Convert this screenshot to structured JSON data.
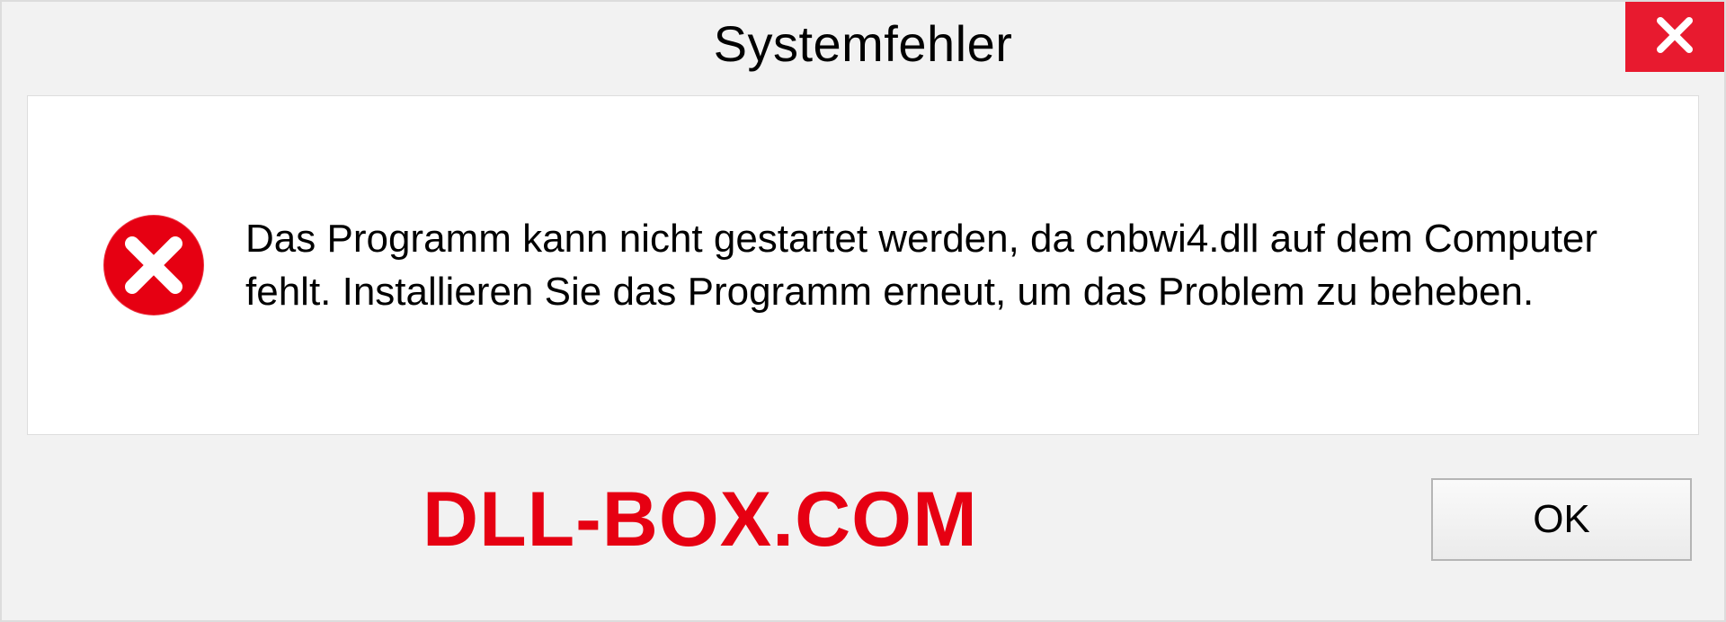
{
  "dialog": {
    "title": "Systemfehler",
    "message": "Das Programm kann nicht gestartet werden, da cnbwi4.dll auf dem Computer fehlt. Installieren Sie das Programm erneut, um das Problem zu beheben.",
    "watermark": "DLL-BOX.COM",
    "ok_label": "OK"
  },
  "icons": {
    "close": "close-icon",
    "error": "error-icon"
  },
  "colors": {
    "accent_red": "#e81a2f",
    "watermark_red": "#e60012",
    "window_bg": "#f2f2f2",
    "panel_bg": "#ffffff"
  }
}
